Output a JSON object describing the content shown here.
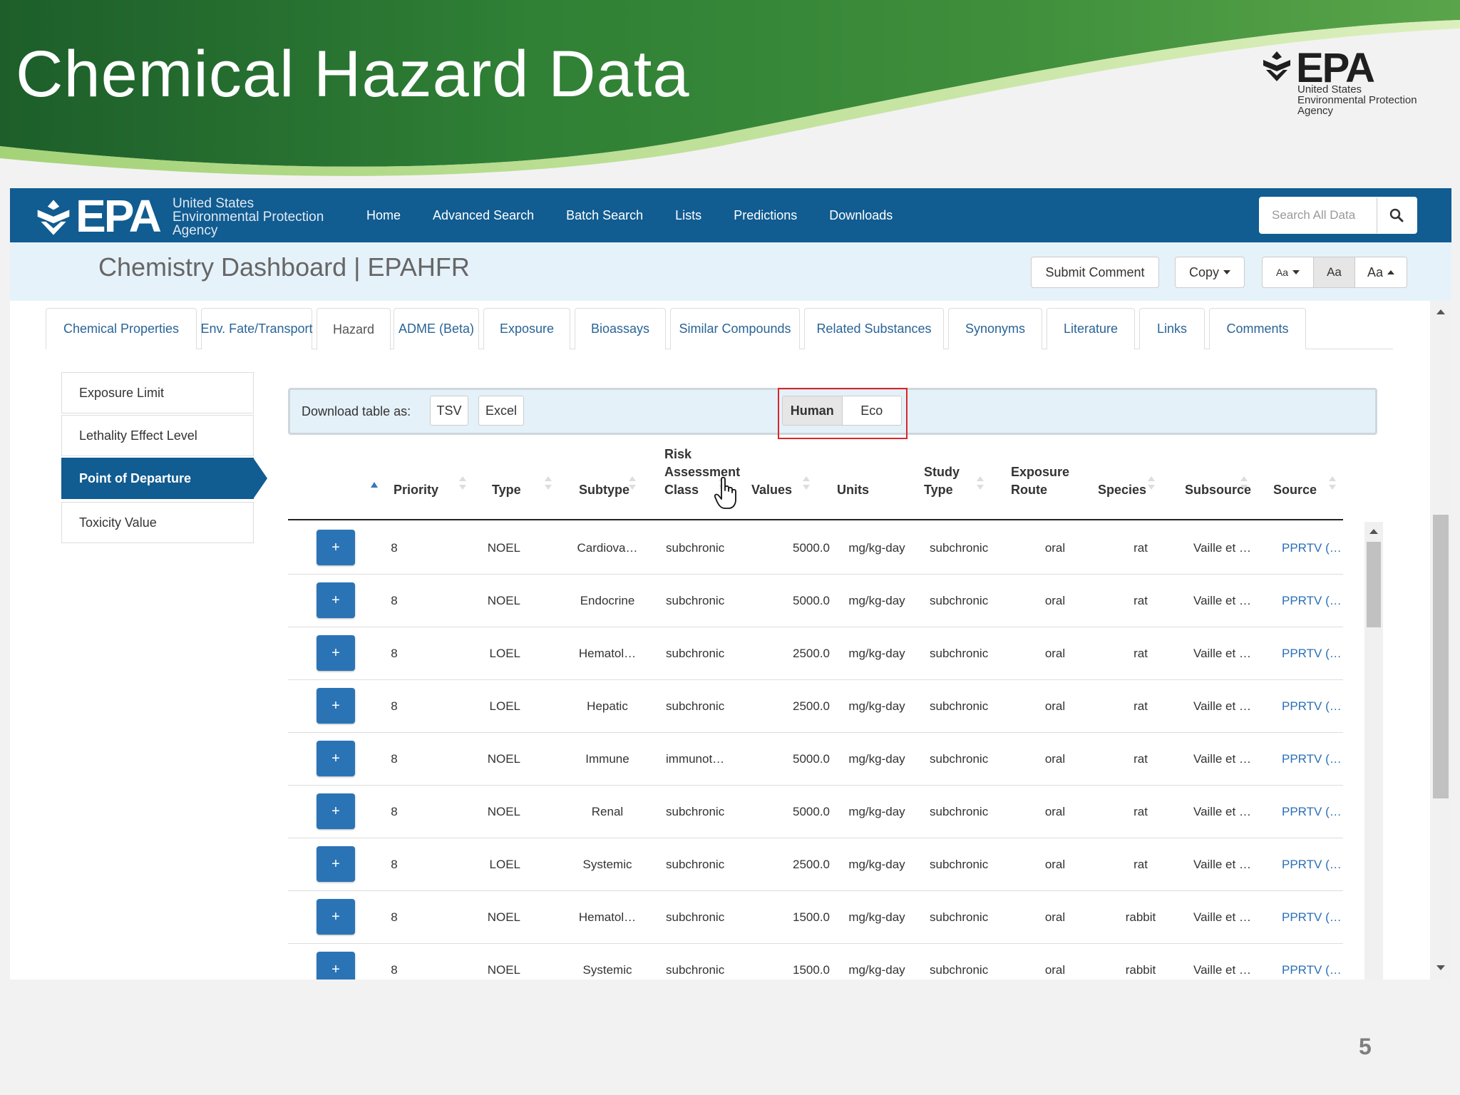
{
  "slide": {
    "title": "Chemical Hazard Data",
    "logo_text": "EPA",
    "logo_sub": [
      "United States",
      "Environmental Protection",
      "Agency"
    ],
    "page_number": "5"
  },
  "navbar": {
    "logo_text": "EPA",
    "logo_sub": [
      "United States",
      "Environmental Protection",
      "Agency"
    ],
    "links": [
      "Home",
      "Advanced Search",
      "Batch Search",
      "Lists",
      "Predictions",
      "Downloads"
    ],
    "search_placeholder": "Search All Data",
    "search_icon": "search-icon"
  },
  "subheader": {
    "title": "Chemistry Dashboard | EPAHFR",
    "submit_comment": "Submit Comment",
    "copy": "Copy",
    "font_small": "Aa",
    "font_medium": "Aa",
    "font_large": "Aa"
  },
  "tabs": [
    "Chemical Properties",
    "Env. Fate/Transport",
    "Hazard",
    "ADME (Beta)",
    "Exposure",
    "Bioassays",
    "Similar Compounds",
    "Related Substances",
    "Synonyms",
    "Literature",
    "Links",
    "Comments"
  ],
  "active_tab": "Hazard",
  "sidebar": {
    "items": [
      "Exposure Limit",
      "Lethality Effect Level",
      "Point of Departure",
      "Toxicity Value"
    ],
    "active": "Point of Departure"
  },
  "toolbar": {
    "download_label": "Download table as:",
    "tsv": "TSV",
    "excel": "Excel",
    "human": "Human",
    "eco": "Eco",
    "selected": "Human"
  },
  "table": {
    "headers": {
      "priority": "Priority",
      "type": "Type",
      "subtype": "Subtype",
      "risk_1": "Risk",
      "risk_2": "Assessment",
      "risk_3": "Class",
      "values": "Values",
      "units": "Units",
      "study_1": "Study",
      "study_2": "Type",
      "route_1": "Exposure",
      "route_2": "Route",
      "species": "Species",
      "subsource": "Subsource",
      "source": "Source"
    },
    "expand_label": "+",
    "rows": [
      {
        "priority": "8",
        "type": "NOEL",
        "subtype": "Cardiova…",
        "risk": "subchronic",
        "value": "5000.0",
        "units": "mg/kg-day",
        "study": "subchronic",
        "route": "oral",
        "species": "rat",
        "subsource": "Vaille et …",
        "source": "PPRTV (…"
      },
      {
        "priority": "8",
        "type": "NOEL",
        "subtype": "Endocrine",
        "risk": "subchronic",
        "value": "5000.0",
        "units": "mg/kg-day",
        "study": "subchronic",
        "route": "oral",
        "species": "rat",
        "subsource": "Vaille et …",
        "source": "PPRTV (…"
      },
      {
        "priority": "8",
        "type": "LOEL",
        "subtype": "Hematol…",
        "risk": "subchronic",
        "value": "2500.0",
        "units": "mg/kg-day",
        "study": "subchronic",
        "route": "oral",
        "species": "rat",
        "subsource": "Vaille et …",
        "source": "PPRTV (…"
      },
      {
        "priority": "8",
        "type": "LOEL",
        "subtype": "Hepatic",
        "risk": "subchronic",
        "value": "2500.0",
        "units": "mg/kg-day",
        "study": "subchronic",
        "route": "oral",
        "species": "rat",
        "subsource": "Vaille et …",
        "source": "PPRTV (…"
      },
      {
        "priority": "8",
        "type": "NOEL",
        "subtype": "Immune",
        "risk": "immunot…",
        "value": "5000.0",
        "units": "mg/kg-day",
        "study": "subchronic",
        "route": "oral",
        "species": "rat",
        "subsource": "Vaille et …",
        "source": "PPRTV (…"
      },
      {
        "priority": "8",
        "type": "NOEL",
        "subtype": "Renal",
        "risk": "subchronic",
        "value": "5000.0",
        "units": "mg/kg-day",
        "study": "subchronic",
        "route": "oral",
        "species": "rat",
        "subsource": "Vaille et …",
        "source": "PPRTV (…"
      },
      {
        "priority": "8",
        "type": "LOEL",
        "subtype": "Systemic",
        "risk": "subchronic",
        "value": "2500.0",
        "units": "mg/kg-day",
        "study": "subchronic",
        "route": "oral",
        "species": "rat",
        "subsource": "Vaille et …",
        "source": "PPRTV (…"
      },
      {
        "priority": "8",
        "type": "NOEL",
        "subtype": "Hematol…",
        "risk": "subchronic",
        "value": "1500.0",
        "units": "mg/kg-day",
        "study": "subchronic",
        "route": "oral",
        "species": "rabbit",
        "subsource": "Vaille et …",
        "source": "PPRTV (…"
      },
      {
        "priority": "8",
        "type": "NOEL",
        "subtype": "Systemic",
        "risk": "subchronic",
        "value": "1500.0",
        "units": "mg/kg-day",
        "study": "subchronic",
        "route": "oral",
        "species": "rabbit",
        "subsource": "Vaille et …",
        "source": "PPRTV (…"
      }
    ]
  },
  "colors": {
    "nav_blue": "#115c91",
    "subheader_bg": "#e6f2fa",
    "link_blue": "#2a6fb7",
    "banner_green": "#2e7d32",
    "highlight_red": "#d9262b"
  }
}
